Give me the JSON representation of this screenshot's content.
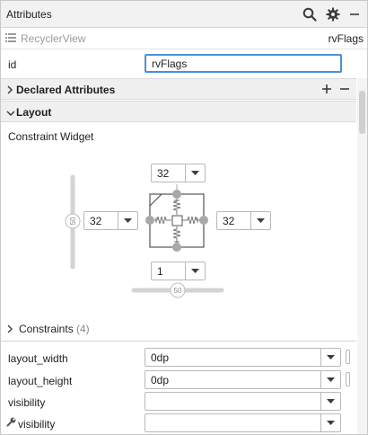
{
  "panel": {
    "title": "Attributes",
    "icons": [
      "search-icon",
      "gear-icon",
      "minimize-icon"
    ]
  },
  "component": {
    "type": "RecyclerView",
    "id": "rvFlags"
  },
  "id_field": {
    "label": "id",
    "value": "rvFlags"
  },
  "sections": {
    "declared": "Declared Attributes",
    "layout": "Layout"
  },
  "constraint_widget": {
    "label": "Constraint Widget",
    "top_margin": "32",
    "left_margin": "32",
    "right_margin": "32",
    "bottom_margin": "1",
    "vertical_bias": "50",
    "horizontal_bias": "50"
  },
  "constraints": {
    "label": "Constraints",
    "count": "(4)"
  },
  "attributes": [
    {
      "label": "layout_width",
      "value": "0dp"
    },
    {
      "label": "layout_height",
      "value": "0dp"
    },
    {
      "label": "visibility",
      "value": ""
    },
    {
      "label": "visibility",
      "value": ""
    }
  ],
  "colors": {
    "accent": "#4a90d9",
    "header_bg": "#f2f2f2",
    "section_bg": "#f0f0f0",
    "constraint_dot": "#a8a8a8"
  }
}
